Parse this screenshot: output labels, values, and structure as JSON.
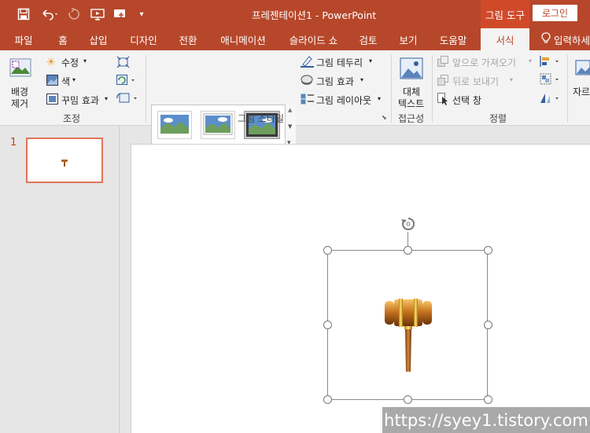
{
  "window": {
    "title": "프레젠테이션1  -  PowerPoint",
    "context_tab_header": "그림 도구",
    "login_label": "로그인"
  },
  "qat": {
    "save": "save-icon",
    "undo": "undo-icon",
    "redo": "redo-icon",
    "from_beginning": "present-icon",
    "touch": "touch-mode-icon",
    "customize": "▾"
  },
  "tabs": [
    {
      "label": "파일"
    },
    {
      "label": "홈"
    },
    {
      "label": "삽입"
    },
    {
      "label": "디자인"
    },
    {
      "label": "전환"
    },
    {
      "label": "애니메이션"
    },
    {
      "label": "슬라이드 쇼"
    },
    {
      "label": "검토"
    },
    {
      "label": "보기"
    },
    {
      "label": "도움말"
    },
    {
      "label": "서식"
    },
    {
      "label": "입력하세"
    }
  ],
  "ribbon": {
    "adjust": {
      "remove_bg": [
        "배경",
        "제거"
      ],
      "corrections": "수정",
      "color": "색",
      "artistic": "꾸밈 효과",
      "label": "조정"
    },
    "styles": {
      "border": "그림 테두리",
      "effects": "그림 효과",
      "layout": "그림 레이아웃",
      "label": "그림 스타일"
    },
    "accessibility": {
      "alt_text": [
        "대체",
        "텍스트"
      ],
      "label": "접근성"
    },
    "arrange": {
      "bring_forward": "앞으로 가져오기",
      "send_backward": "뒤로 보내기",
      "selection_pane": "선택 창",
      "label": "정렬"
    },
    "size": {
      "crop": "자르"
    }
  },
  "slides": {
    "number": "1"
  },
  "watermark": "https://syey1.tistory.com",
  "colors": {
    "accent": "#b7472a",
    "thumb_border": "#e0745a"
  }
}
